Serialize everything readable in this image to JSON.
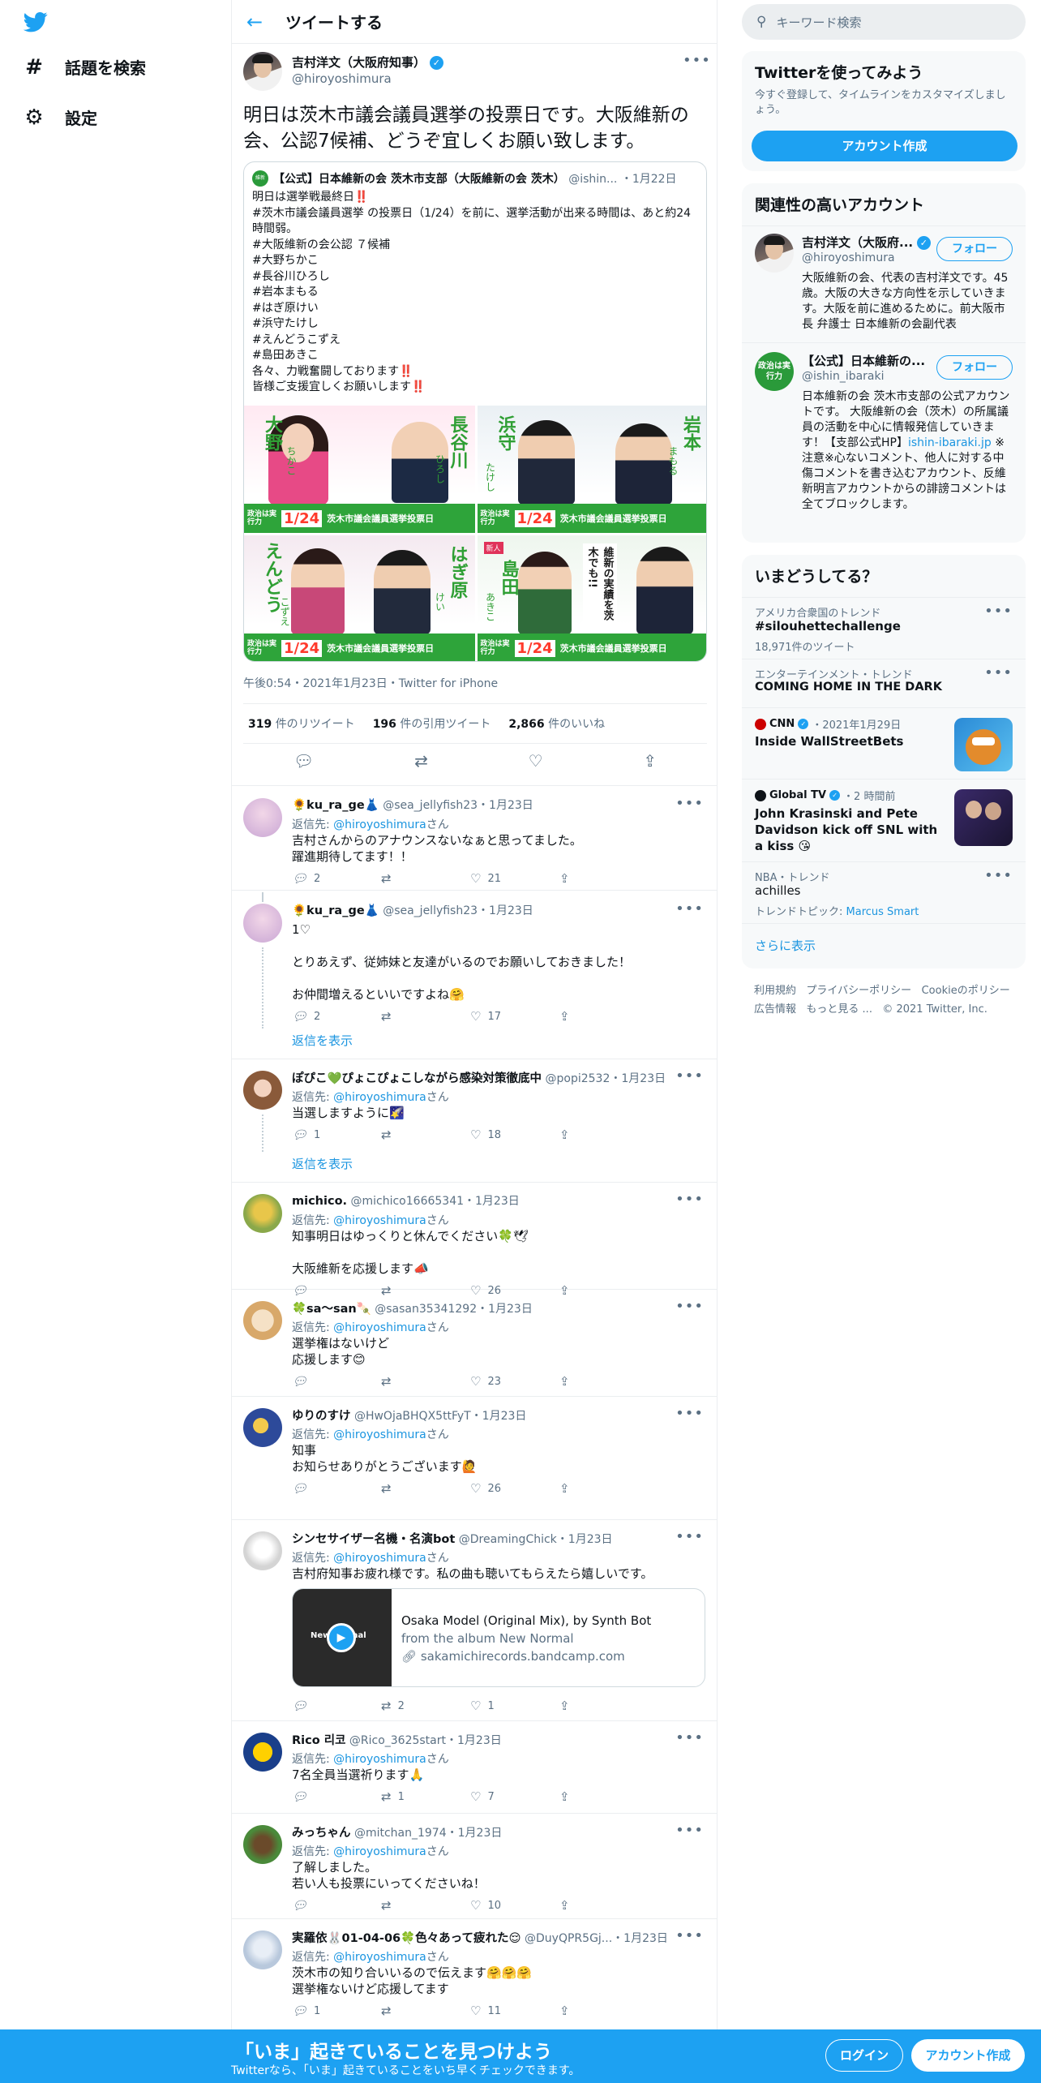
{
  "nav": {
    "explore_label": "話題を検索",
    "settings_label": "設定"
  },
  "header": {
    "title": "ツイートする"
  },
  "main_tweet": {
    "author_name": "吉村洋文（大阪府知事）",
    "author_handle": "@hiroyoshimura",
    "text": "明日は茨木市議会議員選挙の投票日です。大阪維新の会、公認7候補、どうぞ宜しくお願い致します。",
    "quote": {
      "author_name": "【公式】日本維新の会 茨木市支部（大阪維新の会 茨木）",
      "author_handle": "@ishin...",
      "date": "・1月22日",
      "text": "明日は選挙戦最終日‼️\n#茨木市議会議員選挙 の投票日（1/24）を前に、選挙活動が出来る時間は、あと約24時間弱。\n#大阪維新の会公認 ７候補\n#大野ちかこ\n#長谷川ひろし\n#岩本まもる\n#はぎ原けい\n#浜守たけし\n#えんどうこずえ\n#島田あきこ\n各々、力戦奮闘しております‼️\n皆様ご支援宜しくお願いします‼️",
      "posters": [
        {
          "name_a": "大野",
          "name_b": "ちかこ",
          "name_c": "長谷川",
          "name_d": "ひろし"
        },
        {
          "name_a": "浜守",
          "name_b": "たけし",
          "name_c": "岩本",
          "name_d": "まもる"
        },
        {
          "name_a": "えんどう",
          "name_b": "こずえ",
          "name_c": "はぎ原",
          "name_d": "けい"
        },
        {
          "name_a": "島田",
          "name_b": "あきこ",
          "name_c": "維新の実績を茨木でも!!",
          "name_d": "新人"
        }
      ],
      "poster_band": "茨木市議会議員選挙投票日",
      "poster_tag": "政治は実行力",
      "poster_date": "1/24"
    },
    "timestamp": "午後0:54・2021年1月23日・Twitter for iPhone",
    "retweets": "319",
    "retweets_label": "件のリツイート",
    "quotes": "196",
    "quotes_label": "件の引用ツイート",
    "likes": "2,866",
    "likes_label": "件のいいね"
  },
  "replies": [
    {
      "name": "🌻ku_ra_ge👗",
      "handle": "@sea_jellyfish23",
      "date": "・1月23日",
      "to_prefix": "返信先: ",
      "to": "@hiroyoshimura",
      "to_suffix": "さん",
      "text": "吉村さんからのアナウンスないなぁと思ってました。\n躍進期待してます！！",
      "reply_count": "2",
      "rt_count": "",
      "like_count": "21"
    },
    {
      "name": "🌻ku_ra_ge👗",
      "handle": "@sea_jellyfish23",
      "date": "・1月23日",
      "text": "1♡\n\nとりあえず、従姉妹と友達がいるのでお願いしておきました！\n\nお仲間増えるといいですよね🤗",
      "reply_count": "2",
      "rt_count": "",
      "like_count": "17",
      "show_replies": "返信を表示"
    },
    {
      "name": "ぽぴこ💚ぴょこぴょこしながら感染対策徹底中",
      "handle": "@popi2532",
      "date": "・1月23日",
      "to_prefix": "返信先: ",
      "to": "@hiroyoshimura",
      "to_suffix": "さん",
      "text": "当選しますように🌠",
      "reply_count": "1",
      "rt_count": "",
      "like_count": "18",
      "show_replies": "返信を表示"
    },
    {
      "name": "michico.",
      "handle": "@michico16665341",
      "date": "・1月23日",
      "to_prefix": "返信先: ",
      "to": "@hiroyoshimura",
      "to_suffix": "さん",
      "text": "知事明日はゆっくりと休んでください🍀🕊\n\n大阪維新を応援します📣",
      "reply_count": "",
      "rt_count": "",
      "like_count": "26"
    },
    {
      "name": "🍀sa〜san🍡",
      "handle": "@sasan35341292",
      "date": "・1月23日",
      "to_prefix": "返信先: ",
      "to": "@hiroyoshimura",
      "to_suffix": "さん",
      "text": "選挙権はないけど\n応援します😊",
      "reply_count": "",
      "rt_count": "",
      "like_count": "23"
    },
    {
      "name": "ゆりのすけ",
      "handle": "@HwOjaBHQX5ttFyT",
      "date": "・1月23日",
      "to_prefix": "返信先: ",
      "to": "@hiroyoshimura",
      "to_suffix": "さん",
      "text": "知事\nお知らせありがとうございます🙋",
      "reply_count": "",
      "rt_count": "",
      "like_count": "26"
    },
    {
      "name": "シンセサイザー名機・名演bot",
      "handle": "@DreamingChick",
      "date": "・1月23日",
      "to_prefix": "返信先: ",
      "to": "@hiroyoshimura",
      "to_suffix": "さん",
      "text": "吉村府知事お疲れ様です。私の曲も聴いてもらえたら嬉しいです。",
      "reply_count": "",
      "rt_count": "2",
      "like_count": "1",
      "card": {
        "title": "Osaka Model (Original Mix), by Synth Bot",
        "subtitle": "from the album New Normal",
        "link": "sakamichirecords.bandcamp.com",
        "thumb_text": "New Normal"
      }
    },
    {
      "name": "Rico 리코",
      "handle": "@Rico_3625start",
      "date": "・1月23日",
      "to_prefix": "返信先: ",
      "to": "@hiroyoshimura",
      "to_suffix": "さん",
      "text": "7名全員当選祈ります🙏",
      "reply_count": "",
      "rt_count": "1",
      "like_count": "7"
    },
    {
      "name": "みっちゃん",
      "handle": "@mitchan_1974",
      "date": "・1月23日",
      "to_prefix": "返信先: ",
      "to": "@hiroyoshimura",
      "to_suffix": "さん",
      "text": "了解しました。\n若い人も投票にいってくださいね！",
      "reply_count": "",
      "rt_count": "",
      "like_count": "10"
    },
    {
      "name": "実羅依🐰01-04-06🍀色々あって疲れた😌",
      "handle": "@DuyQPR5Gj...",
      "date": "・1月23日",
      "to_prefix": "返信先: ",
      "to": "@hiroyoshimura",
      "to_suffix": "さん",
      "text": "茨木市の知り合いいるので伝えます🤗🤗🤗\n選挙権ないけど応援してます",
      "reply_count": "1",
      "rt_count": "",
      "like_count": "11"
    }
  ],
  "sidebar": {
    "search_placeholder": "キーワード検索",
    "signup": {
      "title": "Twitterを使ってみよう",
      "desc": "今すぐ登録して、タイムラインをカスタマイズしましょう。",
      "button": "アカウント作成"
    },
    "who_to_follow": {
      "title": "関連性の高いアカウント",
      "accounts": [
        {
          "name": "吉村洋文（大阪府...",
          "handle": "@hiroyoshimura",
          "bio": "大阪維新の会、代表の吉村洋文です。45歳。大阪の大きな方向性を示していきます。大阪を前に進めるために。前大阪市長 弁護士 日本維新の会副代表",
          "button": "フォロー"
        },
        {
          "name": "【公式】日本維新の...",
          "handle": "@ishin_ibaraki",
          "bio_a": "日本維新の会 茨木市支部の公式アカウントです。 大阪維新の会（茨木）の所属議員の活動を中心に情報発信していきます！【支部公式HP】",
          "bio_link": "ishin-ibaraki.jp",
          "bio_b": " ※注意※心ないコメント、他人に対する中傷コメントを書き込むアカウント、反維新明言アカウントからの誹謗コメントは全てブロックします。",
          "button": "フォロー",
          "avatar_text": "政治は実行力"
        }
      ]
    },
    "trends": {
      "title": "いまどうしてる？",
      "items": [
        {
          "meta": "アメリカ合衆国のトレンド",
          "title": "#silouhettechallenge",
          "count": "18,971件のツイート"
        },
        {
          "meta": "エンターテインメント・トレンド",
          "title": "COMING HOME IN THE DARK"
        },
        {
          "meta_source": "CNN",
          "meta_date": "・2021年1月29日",
          "title": "Inside WallStreetBets"
        },
        {
          "meta_source": "Global TV",
          "meta_date": "・2 時間前",
          "title": "John Krasinski and Pete Davidson kick off SNL with a kiss 😘"
        },
        {
          "meta": "NBA・トレンド",
          "title": "achilles",
          "topic_prefix": "トレンドトピック: ",
          "topic": "Marcus Smart"
        }
      ],
      "show_more": "さらに表示"
    },
    "footer": {
      "links": [
        "利用規約",
        "プライバシーポリシー",
        "Cookieのポリシー",
        "広告情報",
        "もっと見る ..."
      ],
      "copyright": "© 2021 Twitter, Inc."
    }
  },
  "bottom_bar": {
    "title": "「いま」起きていることを見つけよう",
    "subtitle": "Twitterなら、「いま」起きていることをいち早くチェックできます。",
    "login": "ログイン",
    "signup": "アカウント作成"
  }
}
